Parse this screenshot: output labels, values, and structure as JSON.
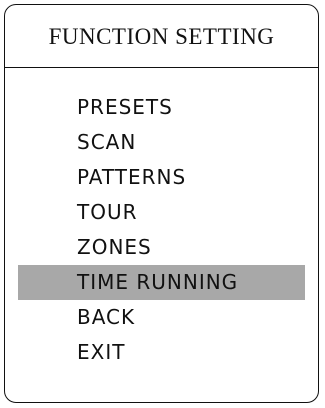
{
  "menu": {
    "title": "FUNCTION SETTING",
    "selected_index": 5,
    "items": [
      {
        "label": "PRESETS"
      },
      {
        "label": "SCAN"
      },
      {
        "label": "PATTERNS"
      },
      {
        "label": "TOUR"
      },
      {
        "label": "ZONES"
      },
      {
        "label": "TIME RUNNING"
      },
      {
        "label": "BACK"
      },
      {
        "label": "EXIT"
      }
    ]
  },
  "colors": {
    "border": "#111111",
    "text": "#111111",
    "highlight": "#a8a8a8",
    "background": "#ffffff"
  }
}
